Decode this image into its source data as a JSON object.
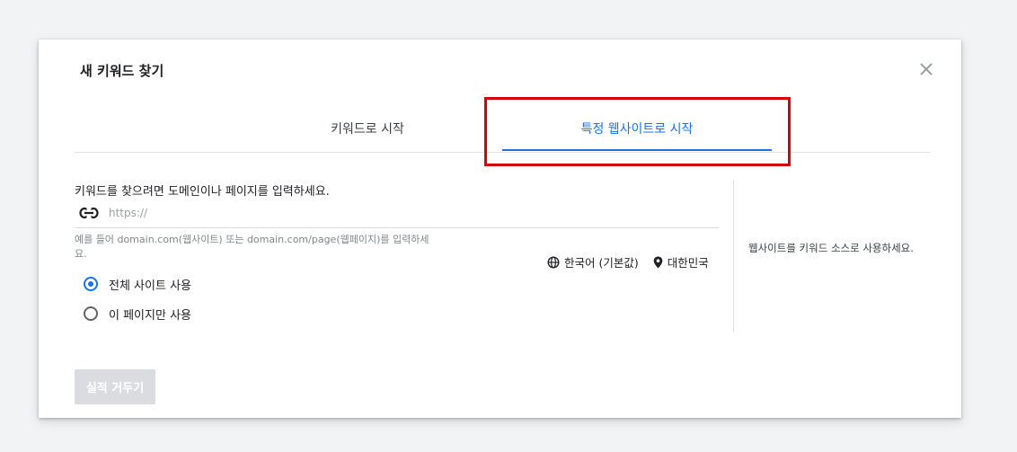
{
  "dialog": {
    "title": "새 키워드 찾기",
    "close_icon": "close-icon"
  },
  "tabs": [
    {
      "label": "키워드로 시작",
      "active": false
    },
    {
      "label": "특정 웹사이트로 시작",
      "active": true
    }
  ],
  "form": {
    "prompt": "키워드를 찾으려면 도메인이나 페이지를 입력하세요.",
    "url_placeholder": "https://",
    "url_value": "",
    "hint": "예를 들어 domain.com(웹사이트) 또는 domain.com/page(웹페이지)를 입력하세요.",
    "language": "한국어 (기본값)",
    "location": "대한민국",
    "scope_options": [
      {
        "label": "전체 사이트 사용",
        "selected": true
      },
      {
        "label": "이 페이지만 사용",
        "selected": false
      }
    ]
  },
  "side_note": "웹사이트를 키워드 소스로 사용하세요.",
  "submit_label": "실적 거두기",
  "colors": {
    "accent": "#1a73e8",
    "highlight_border": "#d50000",
    "disabled_button": "#dadce0"
  }
}
